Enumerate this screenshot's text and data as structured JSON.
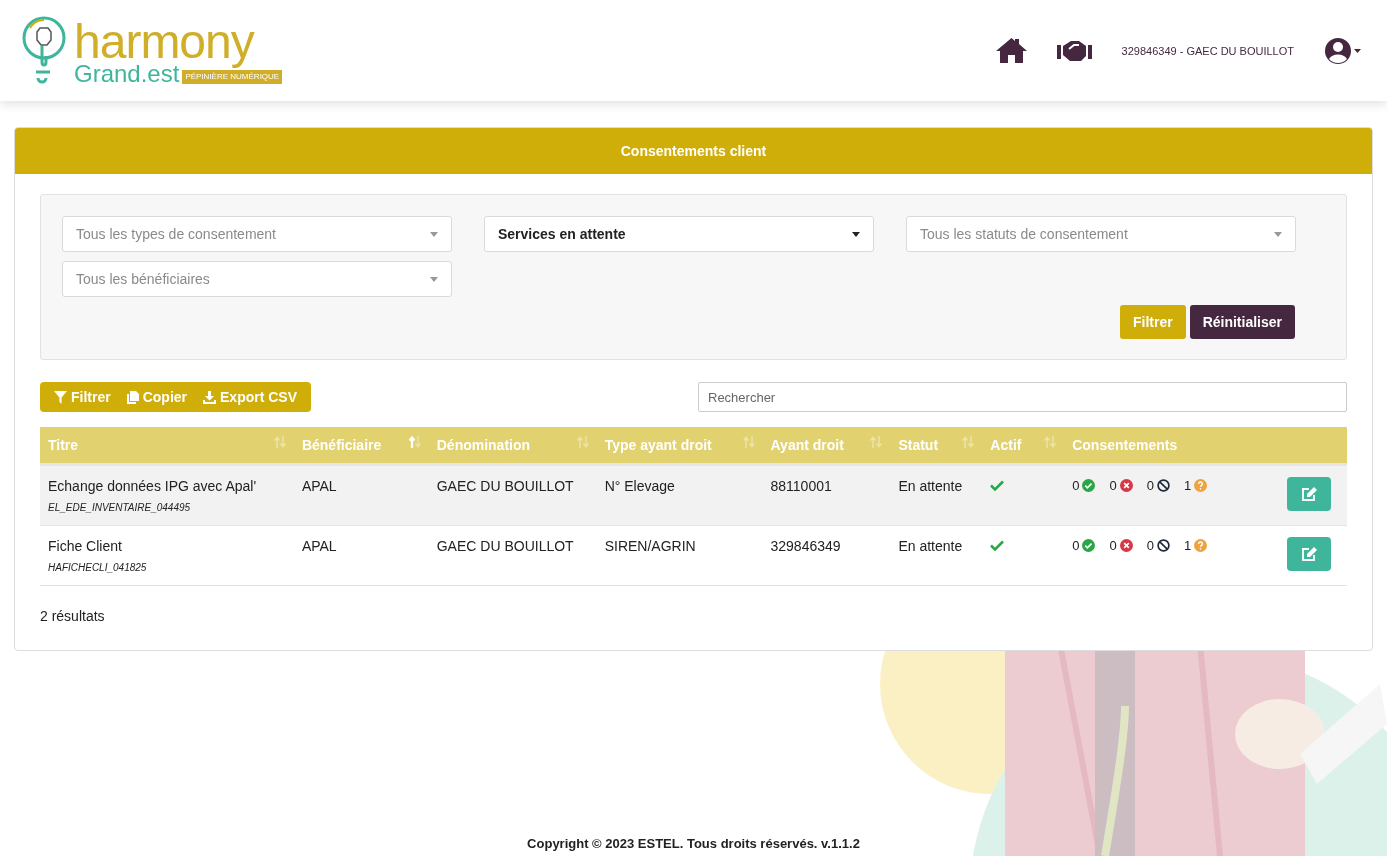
{
  "header": {
    "logo": {
      "word": "harmony",
      "region": "Grand.est",
      "tagline": "PÉPINIÈRE NUMÉRIQUE"
    },
    "account": "329846349 - GAEC DU BOUILLOT"
  },
  "card": {
    "title": "Consentements client",
    "filters": [
      {
        "placeholder": "Tous les types de consentement"
      },
      {
        "value": "Services en attente"
      },
      {
        "placeholder": "Tous les statuts de consentement"
      },
      {
        "placeholder": "Tous les bénéficiaires"
      }
    ],
    "filter_buttons": [
      {
        "label": "Filtrer",
        "kind": "primary"
      },
      {
        "label": "Réinitialiser",
        "kind": "secondary"
      }
    ],
    "toolbar": [
      {
        "label": "Filtrer",
        "kind": "filter"
      },
      {
        "label": "Copier",
        "kind": "copy"
      },
      {
        "label": "Export CSV",
        "kind": "download"
      }
    ],
    "search": {
      "placeholder": "Rechercher"
    },
    "table": {
      "columns": [
        {
          "label": "Titre",
          "sortable": true,
          "sorted": false
        },
        {
          "label": "Bénéficiaire",
          "sortable": true,
          "sorted": true
        },
        {
          "label": "Dénomination",
          "sortable": true,
          "sorted": false
        },
        {
          "label": "Type ayant droit",
          "sortable": true,
          "sorted": false
        },
        {
          "label": "Ayant droit",
          "sortable": true,
          "sorted": false
        },
        {
          "label": "Statut",
          "sortable": true,
          "sorted": false
        },
        {
          "label": "Actif",
          "sortable": true,
          "sorted": false
        },
        {
          "label": "Consentements"
        }
      ],
      "rows": [
        {
          "title": "Echange données IPG avec Apal'",
          "code": "EL_EDE_INVENTAIRE_044495",
          "beneficiary": "APAL",
          "denomination": "GAEC DU BOUILLOT",
          "type": "N° Elevage",
          "holder": "88110001",
          "status": "En attente",
          "active": true,
          "consents": [
            {
              "kind": "accepted",
              "count": "0"
            },
            {
              "kind": "refused",
              "count": "0"
            },
            {
              "kind": "revoked",
              "count": "0"
            },
            {
              "kind": "pending",
              "count": "1"
            }
          ]
        },
        {
          "title": "Fiche Client",
          "code": "HAFICHECLI_041825",
          "beneficiary": "APAL",
          "denomination": "GAEC DU BOUILLOT",
          "type": "SIREN/AGRIN",
          "holder": "329846349",
          "status": "En attente",
          "active": true,
          "consents": [
            {
              "kind": "accepted",
              "count": "0"
            },
            {
              "kind": "refused",
              "count": "0"
            },
            {
              "kind": "revoked",
              "count": "0"
            },
            {
              "kind": "pending",
              "count": "1"
            }
          ]
        }
      ]
    },
    "results": "2 résultats"
  },
  "footer": "Copyright © 2023 ESTEL. Tous droits réservés. v.1.1.2"
}
